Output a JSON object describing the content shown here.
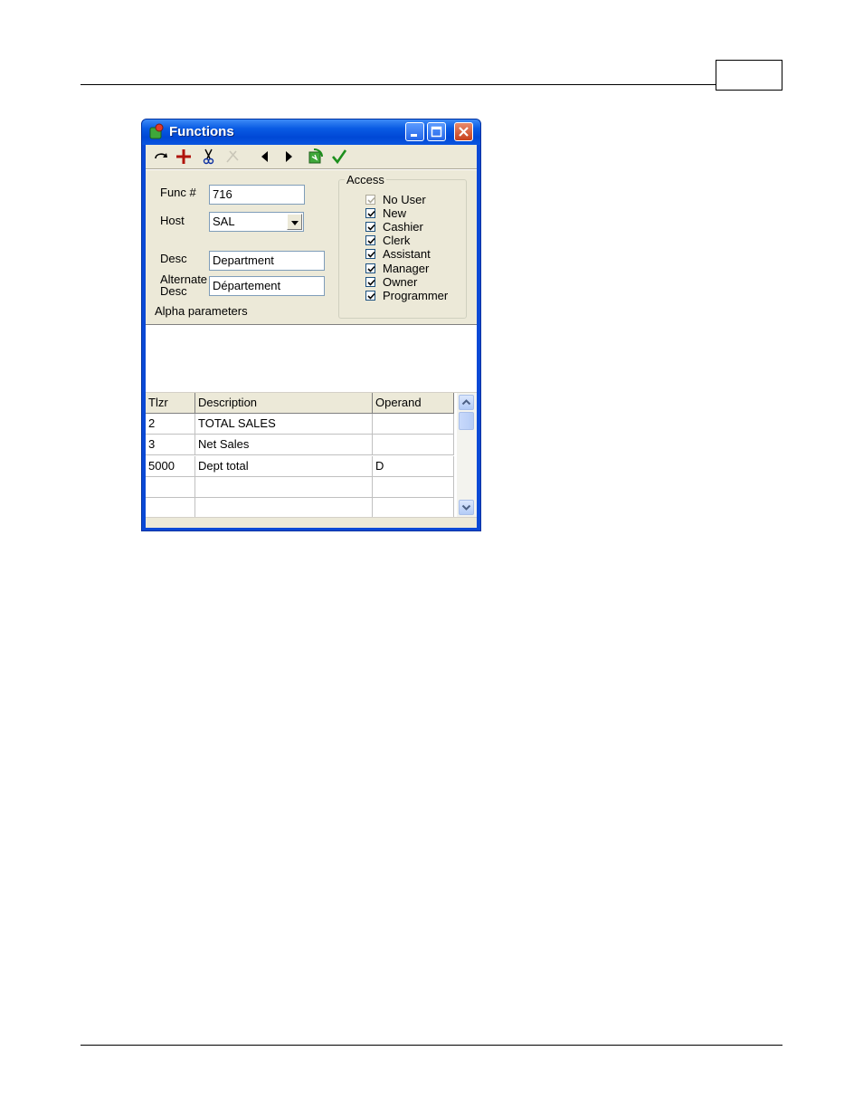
{
  "page": {
    "page_number": ""
  },
  "window": {
    "title": "Functions"
  },
  "toolbar": {
    "icons": [
      "undo-arrow-icon",
      "add-plus-icon",
      "cut-scissors-icon",
      "disabled-cut-icon",
      "previous-arrow-icon",
      "next-arrow-icon",
      "refresh-icon",
      "ok-checkmark-icon"
    ]
  },
  "form": {
    "func_label": "Func #",
    "func_value": "716",
    "host_label": "Host",
    "host_value": "SAL",
    "desc_label": "Desc",
    "desc_value": "Department",
    "alt_desc_label_1": "Alternate",
    "alt_desc_label_2": "Desc",
    "alt_desc_value": "Département",
    "alpha_params_label": "Alpha parameters"
  },
  "access": {
    "title": "Access",
    "items": [
      {
        "label": "No User",
        "checked": true,
        "disabled": true
      },
      {
        "label": "New",
        "checked": true,
        "disabled": false
      },
      {
        "label": "Cashier",
        "checked": true,
        "disabled": false
      },
      {
        "label": "Clerk",
        "checked": true,
        "disabled": false
      },
      {
        "label": "Assistant",
        "checked": true,
        "disabled": false
      },
      {
        "label": "Manager",
        "checked": true,
        "disabled": false
      },
      {
        "label": "Owner",
        "checked": true,
        "disabled": false
      },
      {
        "label": "Programmer",
        "checked": true,
        "disabled": false
      }
    ]
  },
  "grid": {
    "columns": [
      "Tlzr",
      "Description",
      "Operand"
    ],
    "rows": [
      [
        "2",
        "TOTAL SALES",
        ""
      ],
      [
        "3",
        "Net Sales",
        ""
      ],
      [
        "5000",
        "Dept total",
        "D"
      ],
      [
        "",
        "",
        ""
      ],
      [
        "",
        "",
        ""
      ]
    ]
  },
  "colors": {
    "titlebar": "#0a5ce4",
    "client": "#ece9d8",
    "close_button": "#c8401c"
  }
}
